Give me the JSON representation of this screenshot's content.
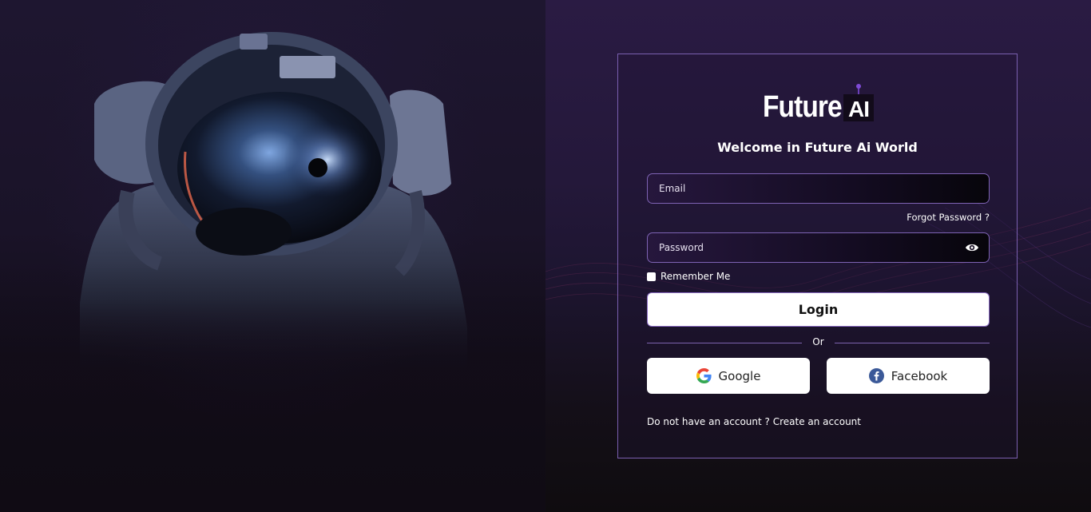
{
  "brand": {
    "logo_main": "Future",
    "logo_ai": "AI"
  },
  "welcome_text": "Welcome in Future Ai World",
  "email_field": {
    "placeholder": "Email"
  },
  "forgot_password": "Forgot Password ?",
  "password_field": {
    "placeholder": "Password"
  },
  "remember_me": "Remember Me",
  "login_button": "Login",
  "divider_text": "Or",
  "social": {
    "google_label": "Google",
    "facebook_label": "Facebook"
  },
  "signup": {
    "prompt": "Do not have an account ?",
    "link": "Create an account"
  },
  "colors": {
    "accent_border": "#7a5fb0",
    "background": "#24183a"
  }
}
